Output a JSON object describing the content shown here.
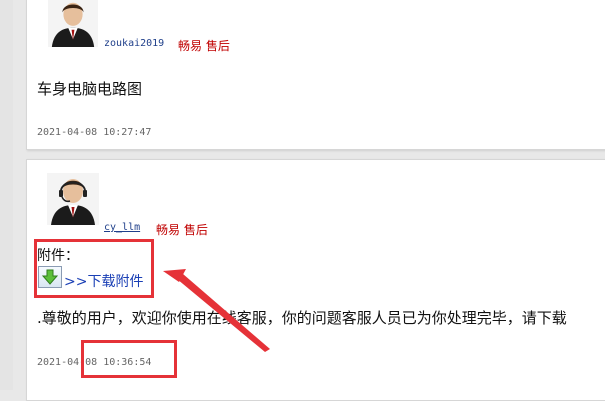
{
  "posts": [
    {
      "username": "zoukai2019",
      "role": "畅易 售后",
      "content": "车身电脑电路图",
      "timestamp": "2021-04-08 10:27:47"
    },
    {
      "username": "cy_llm",
      "role": "畅易 售后",
      "attachment_label": "附件：",
      "download_text": ">>下载附件",
      "notice": ".尊敬的用户，欢迎你使用在线客服，你的问题客服人员已为你处理完毕，请下载",
      "timestamp": "2021-04-08 10:36:54"
    }
  ],
  "annotation_color": "#e53238"
}
